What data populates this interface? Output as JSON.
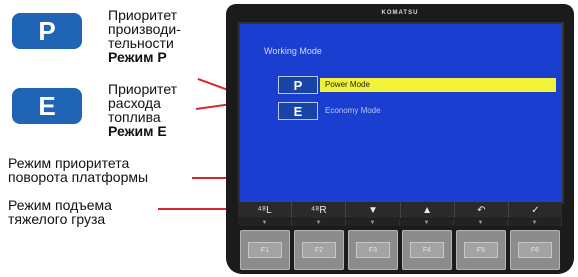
{
  "legend": {
    "p_key": "P",
    "p_desc_lines": [
      "Приоритет",
      "производи-",
      "тельности"
    ],
    "p_mode": "Режим P",
    "e_key": "E",
    "e_desc_lines": [
      "Приоритет",
      "расхода",
      "топлива"
    ],
    "e_mode": "Режим E",
    "swing_lines": [
      "Режим приоритета",
      "поворота платформы"
    ],
    "heavy_lines": [
      "Режим подъема",
      "тяжелого груза"
    ]
  },
  "monitor": {
    "brand": "KOMATSU",
    "screen_title": "Working Mode",
    "mode_p_key": "P",
    "mode_p_label": "Power Mode",
    "mode_e_key": "E",
    "mode_e_label": "Economy Mode",
    "fn_labels": [
      "⁴⁸L",
      "⁴⁸R",
      "▼",
      "▲",
      "↶",
      "✓"
    ],
    "arrow": "▼",
    "fkeys": [
      "F1",
      "F2",
      "F3",
      "F4",
      "F5",
      "F6"
    ]
  },
  "colors": {
    "accent_blue": "#1f64b5",
    "screen_blue": "#1a3fd0",
    "selected_yellow": "#f1f23a",
    "callout_red": "#d8262e"
  }
}
